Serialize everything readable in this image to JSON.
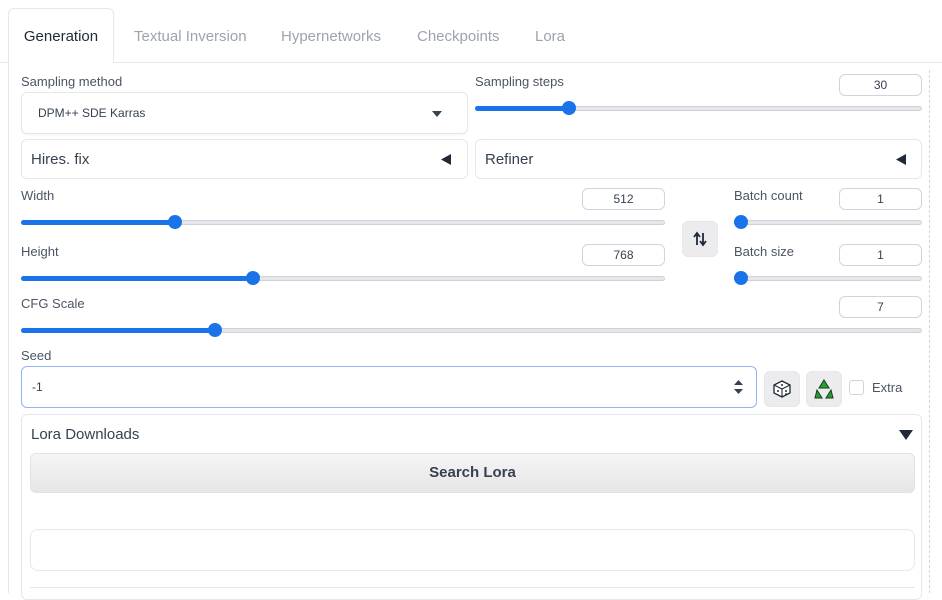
{
  "tabs": [
    {
      "label": "Generation",
      "active": true
    },
    {
      "label": "Textual Inversion"
    },
    {
      "label": "Hypernetworks"
    },
    {
      "label": "Checkpoints"
    },
    {
      "label": "Lora"
    }
  ],
  "sampling_method": {
    "label": "Sampling method",
    "value": "DPM++ SDE Karras"
  },
  "sampling_steps": {
    "label": "Sampling steps",
    "value": "30",
    "fraction": 0.2
  },
  "hires_fix": {
    "label": "Hires. fix"
  },
  "refiner": {
    "label": "Refiner"
  },
  "width": {
    "label": "Width",
    "value": "512",
    "fraction": 0.233
  },
  "height": {
    "label": "Height",
    "value": "768",
    "fraction": 0.357
  },
  "batch_count": {
    "label": "Batch count",
    "value": "1",
    "fraction": 0.0
  },
  "batch_size": {
    "label": "Batch size",
    "value": "1",
    "fraction": 0.0
  },
  "cfg_scale": {
    "label": "CFG Scale",
    "value": "7",
    "fraction": 0.211
  },
  "seed": {
    "label": "Seed",
    "value": "-1"
  },
  "extra": {
    "label": "Extra",
    "checked": false
  },
  "lora_downloads": {
    "title": "Lora Downloads",
    "search_button": "Search Lora"
  },
  "colors": {
    "accent": "#1a73e8",
    "border": "#e5e7eb"
  }
}
